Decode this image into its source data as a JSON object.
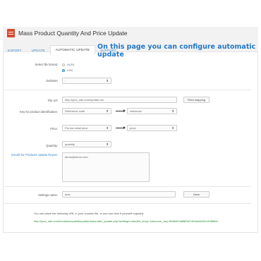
{
  "header": {
    "title": "Mass Product Quantity And Price Update"
  },
  "tabs": [
    {
      "label": "EXPORT"
    },
    {
      "label": "UPDATE"
    },
    {
      "label": "AUTOMATIC UPDATE"
    },
    {
      "label": "SUPPORT"
    }
  ],
  "headline": "On this page you can configure automatic update",
  "form": {
    "file_format_label": "Select file format:",
    "format_options": [
      "XLSX",
      "CSV"
    ],
    "delimiter_label": "Delimiter",
    "delimiter_value": ";",
    "file_url_label": "File Url:",
    "file_url_value": "http://your_site.com/update.csv",
    "field_mapping_button": "Field mapping",
    "key_label": "Key for product identification:",
    "key_from": "Reference code",
    "key_to": "reference",
    "price_label": "Price:",
    "price_from": "Pre-tax retail price",
    "price_to": "price",
    "quantity_label": "Quantity:",
    "quantity_value": "quantity",
    "emails_label": "Emails for Products Update Report:",
    "emails_value": "demo@demo.com",
    "settings_name_label": "Settings name:",
    "settings_name_value": "auto",
    "save_button": "Save"
  },
  "footer": {
    "note": "You can place the following URL in your crontab file, or you can click it yourself regularly",
    "cron_url": "http://your_site.com/modules/quantityupdate/automatic_update.php?settings=auto&id_shop=1&secure_key=9b8b0f7a8f8f0fe7464ea9b0f11428fbbb"
  },
  "colors": {
    "accent": "#2478c5",
    "link": "#3a86c8",
    "url": "#2a8a3a",
    "logo": "#d9472b"
  }
}
